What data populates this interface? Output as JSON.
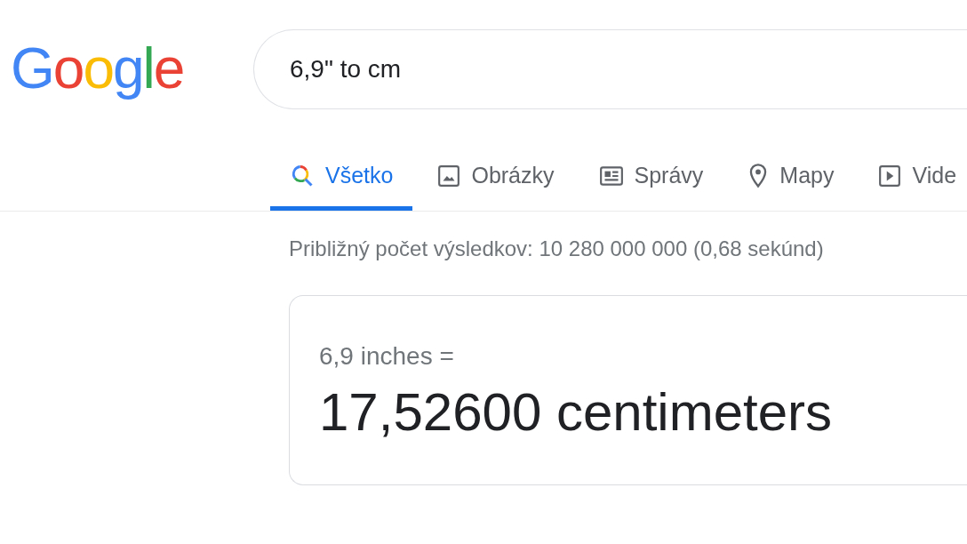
{
  "logo": [
    {
      "letter": "G",
      "color": "#4285f4"
    },
    {
      "letter": "o",
      "color": "#ea4335"
    },
    {
      "letter": "o",
      "color": "#fbbc05"
    },
    {
      "letter": "g",
      "color": "#4285f4"
    },
    {
      "letter": "l",
      "color": "#34a853"
    },
    {
      "letter": "e",
      "color": "#ea4335"
    }
  ],
  "search": {
    "value": "6,9\" to cm"
  },
  "tabs": [
    {
      "kind": "all",
      "label": "Všetko",
      "selected": true
    },
    {
      "kind": "images",
      "label": "Obrázky",
      "selected": false
    },
    {
      "kind": "news",
      "label": "Správy",
      "selected": false
    },
    {
      "kind": "maps",
      "label": "Mapy",
      "selected": false
    },
    {
      "kind": "videos",
      "label": "Vide",
      "selected": false
    }
  ],
  "result_stats": "Približný počet výsledkov: 10 280 000 000 (0,68 sekúnd)",
  "converter": {
    "from": "6,9 inches =",
    "to": "17,52600 centimeters"
  }
}
